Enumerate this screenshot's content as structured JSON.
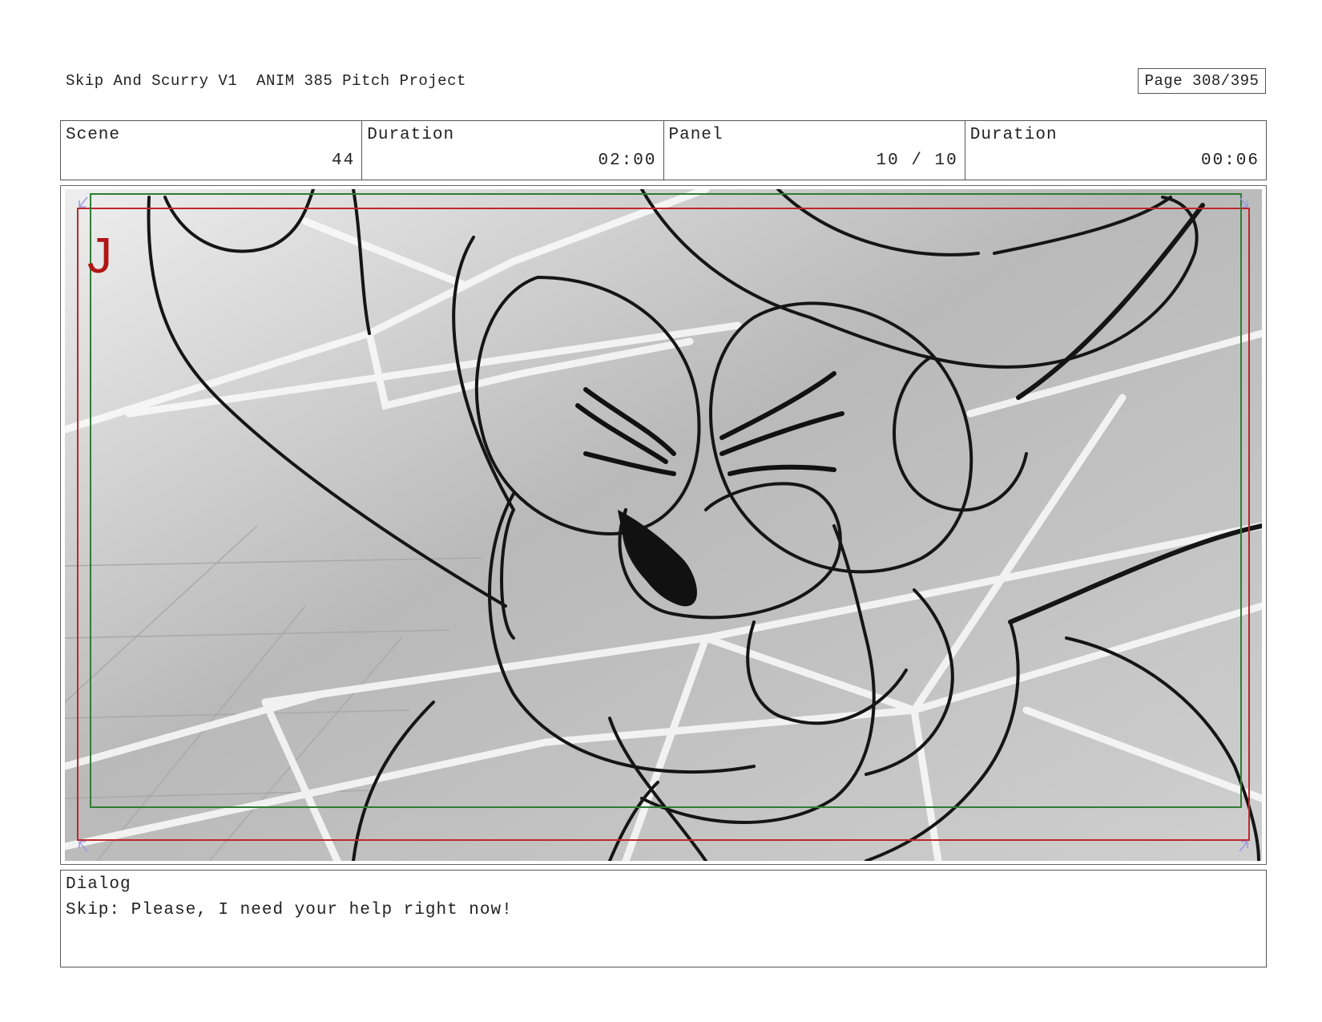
{
  "header": {
    "title": "Skip And Scurry V1  ANIM 385 Pitch Project",
    "page": "Page 308/395"
  },
  "info": {
    "scene_label": "Scene",
    "scene_value": "44",
    "scene_duration_label": "Duration",
    "scene_duration_value": "02:00",
    "panel_label": "Panel",
    "panel_value": "10 / 10",
    "panel_duration_label": "Duration",
    "panel_duration_value": "00:06"
  },
  "panel": {
    "marker": "J",
    "marker_color": "#b01515",
    "action_safe_color": "#c0262b",
    "title_safe_color": "#2e7d32"
  },
  "dialog": {
    "label": "Dialog",
    "text": "Skip: Please, I need your help right now!"
  }
}
